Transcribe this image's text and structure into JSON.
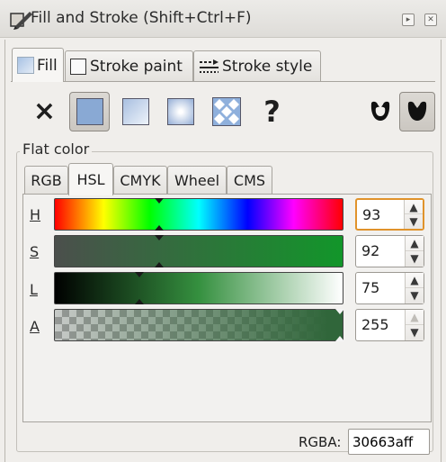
{
  "window": {
    "title": "Fill and Stroke (Shift+Ctrl+F)",
    "buttons": [
      "▸",
      "✕"
    ]
  },
  "tabs": [
    {
      "label": "Fill",
      "active": true
    },
    {
      "label": "Stroke paint",
      "active": false
    },
    {
      "label": "Stroke style",
      "active": false
    }
  ],
  "paint_types": [
    "no-paint",
    "flat-color",
    "linear-gradient",
    "radial-gradient",
    "pattern",
    "unset"
  ],
  "paint_labels": {
    "none": "×",
    "unset": "?"
  },
  "fill_rule_icons": [
    "evenodd-fill-icon",
    "nonzero-fill-icon"
  ],
  "flat_color": {
    "label": "Flat color",
    "modes": [
      "RGB",
      "HSL",
      "CMYK",
      "Wheel",
      "CMS"
    ],
    "active_mode": "HSL",
    "sliders": [
      {
        "label": "H",
        "value": "93"
      },
      {
        "label": "S",
        "value": "92"
      },
      {
        "label": "L",
        "value": "75"
      },
      {
        "label": "A",
        "value": "255"
      }
    ],
    "rgba_label": "RGBA:",
    "rgba_value": "30663aff"
  },
  "colors": {
    "current": "#30663a",
    "focus": "#e0932b"
  }
}
